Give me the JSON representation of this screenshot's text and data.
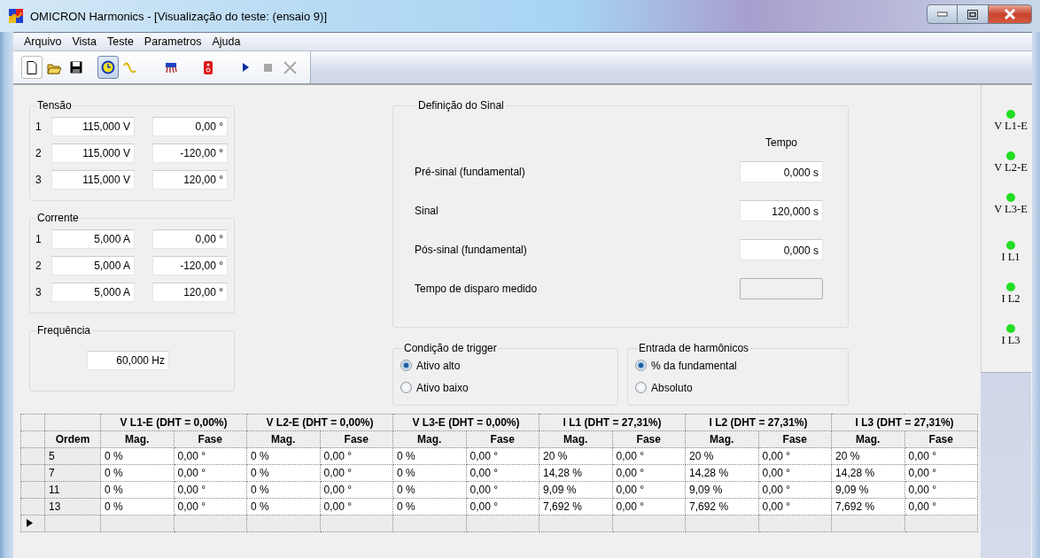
{
  "window": {
    "title": "OMICRON Harmonics - [Visualização do teste: (ensaio 9)]"
  },
  "menu": [
    "Arquivo",
    "Vista",
    "Teste",
    "Parametros",
    "Ajuda"
  ],
  "toolbar": [
    {
      "kind": "new",
      "pressed": false,
      "disabled": false
    },
    {
      "kind": "open",
      "pressed": false,
      "disabled": false
    },
    {
      "kind": "save",
      "pressed": false,
      "disabled": false
    },
    {
      "kind": "clock",
      "pressed": true,
      "disabled": false
    },
    {
      "kind": "sine",
      "pressed": false,
      "disabled": false
    },
    {
      "kind": "device",
      "pressed": false,
      "disabled": false
    },
    {
      "kind": "redbox",
      "pressed": false,
      "disabled": false
    },
    {
      "kind": "play",
      "pressed": false,
      "disabled": false
    },
    {
      "kind": "stop",
      "pressed": false,
      "disabled": true
    },
    {
      "kind": "cancel",
      "pressed": false,
      "disabled": true
    }
  ],
  "tensao": {
    "title": "Tensão",
    "rows": [
      {
        "index": "1",
        "magnitude": "115,000 V",
        "angle": "0,00 °"
      },
      {
        "index": "2",
        "magnitude": "115,000 V",
        "angle": "-120,00 °"
      },
      {
        "index": "3",
        "magnitude": "115,000 V",
        "angle": "120,00 °"
      }
    ]
  },
  "corrente": {
    "title": "Corrente",
    "rows": [
      {
        "index": "1",
        "magnitude": "5,000 A",
        "angle": "0,00 °"
      },
      {
        "index": "2",
        "magnitude": "5,000 A",
        "angle": "-120,00 °"
      },
      {
        "index": "3",
        "magnitude": "5,000 A",
        "angle": "120,00 °"
      }
    ]
  },
  "frequencia": {
    "title": "Frequência",
    "value": "60,000 Hz"
  },
  "sinal": {
    "title": "Definição do Sinal",
    "column_header": "Tempo",
    "rows": [
      {
        "label": "Pré-sinal (fundamental)",
        "value": "0,000 s",
        "disabled": false
      },
      {
        "label": "Sinal",
        "value": "120,000 s",
        "disabled": false
      },
      {
        "label": "Pós-sinal (fundamental)",
        "value": "0,000 s",
        "disabled": false
      },
      {
        "label": "Tempo de disparo medido",
        "disabled": true
      }
    ]
  },
  "trigger": {
    "title": "Condição de trigger",
    "options": [
      {
        "label": "Ativo alto",
        "selected": true
      },
      {
        "label": "Ativo baixo",
        "selected": false
      }
    ]
  },
  "harmonicos": {
    "title": "Entrada de harmônicos",
    "options": [
      {
        "label": "% da fundamental",
        "selected": true
      },
      {
        "label": "Absoluto",
        "selected": false
      }
    ]
  },
  "channels": [
    {
      "label": "V L1-E",
      "on": true
    },
    {
      "label": "V L2-E",
      "on": true
    },
    {
      "label": "V L3-E",
      "on": true
    },
    {
      "label": "I L1",
      "on": true
    },
    {
      "label": "I L2",
      "on": true
    },
    {
      "label": "I L3",
      "on": true
    }
  ],
  "table": {
    "groups": [
      "V L1-E (DHT = 0,00%)",
      "V L2-E (DHT = 0,00%)",
      "V L3-E (DHT = 0,00%)",
      "I L1 (DHT = 27,31%)",
      "I L2 (DHT = 27,31%)",
      "I L3 (DHT = 27,31%)"
    ],
    "columns": [
      "Ordem",
      "Mag.",
      "Fase",
      "Mag.",
      "Fase",
      "Mag.",
      "Fase",
      "Mag.",
      "Fase",
      "Mag.",
      "Fase",
      "Mag.",
      "Fase"
    ],
    "rows": [
      {
        "selected": false,
        "cells": [
          "5",
          "0 %",
          "0,00 °",
          "0 %",
          "0,00 °",
          "0 %",
          "0,00 °",
          "20 %",
          "0,00 °",
          "20 %",
          "0,00 °",
          "20 %",
          "0,00 °"
        ]
      },
      {
        "selected": false,
        "cells": [
          "7",
          "0 %",
          "0,00 °",
          "0 %",
          "0,00 °",
          "0 %",
          "0,00 °",
          "14,28 %",
          "0,00 °",
          "14,28 %",
          "0,00 °",
          "14,28 %",
          "0,00 °"
        ]
      },
      {
        "selected": false,
        "cells": [
          "11",
          "0 %",
          "0,00 °",
          "0 %",
          "0,00 °",
          "0 %",
          "0,00 °",
          "9,09 %",
          "0,00 °",
          "9,09 %",
          "0,00 °",
          "9,09 %",
          "0,00 °"
        ]
      },
      {
        "selected": false,
        "cells": [
          "13",
          "0 %",
          "0,00 °",
          "0 %",
          "0,00 °",
          "0 %",
          "0,00 °",
          "7,692 %",
          "0,00 °",
          "7,692 %",
          "0,00 °",
          "7,692 %",
          "0,00 °"
        ]
      }
    ],
    "new_row": {
      "selected": true
    }
  }
}
